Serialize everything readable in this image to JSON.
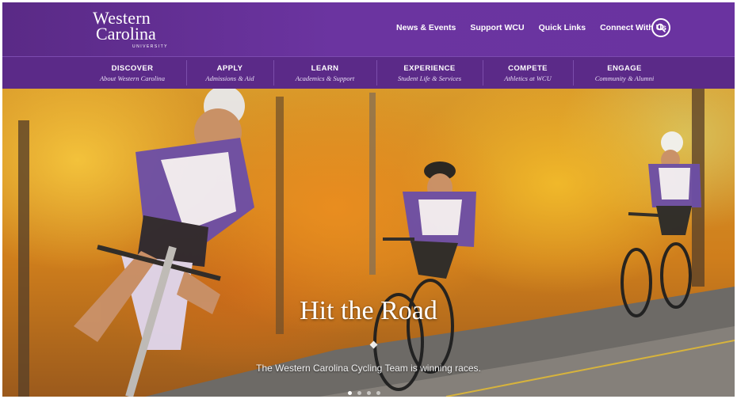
{
  "brand": {
    "line1": "Western",
    "line2": "Carolina",
    "line3": "UNIVERSITY"
  },
  "utility_nav": [
    {
      "label": "News & Events"
    },
    {
      "label": "Support WCU"
    },
    {
      "label": "Quick Links"
    },
    {
      "label": "Connect With Us"
    }
  ],
  "main_nav": [
    {
      "title": "DISCOVER",
      "subtitle": "About Western Carolina"
    },
    {
      "title": "APPLY",
      "subtitle": "Admissions & Aid"
    },
    {
      "title": "LEARN",
      "subtitle": "Academics & Support"
    },
    {
      "title": "EXPERIENCE",
      "subtitle": "Student Life & Services"
    },
    {
      "title": "COMPETE",
      "subtitle": "Athletics at WCU"
    },
    {
      "title": "ENGAGE",
      "subtitle": "Community & Alumni"
    }
  ],
  "hero": {
    "title": "Hit the Road",
    "subtitle": "The Western Carolina Cycling Team is winning races.",
    "slide_dots": 4,
    "active_slide": 1
  },
  "icons": {
    "search": "search-icon",
    "carousel_marker": "diamond-icon"
  },
  "colors": {
    "brand_purple": "#5b2a88",
    "brand_purple_light": "#6b34a0"
  }
}
